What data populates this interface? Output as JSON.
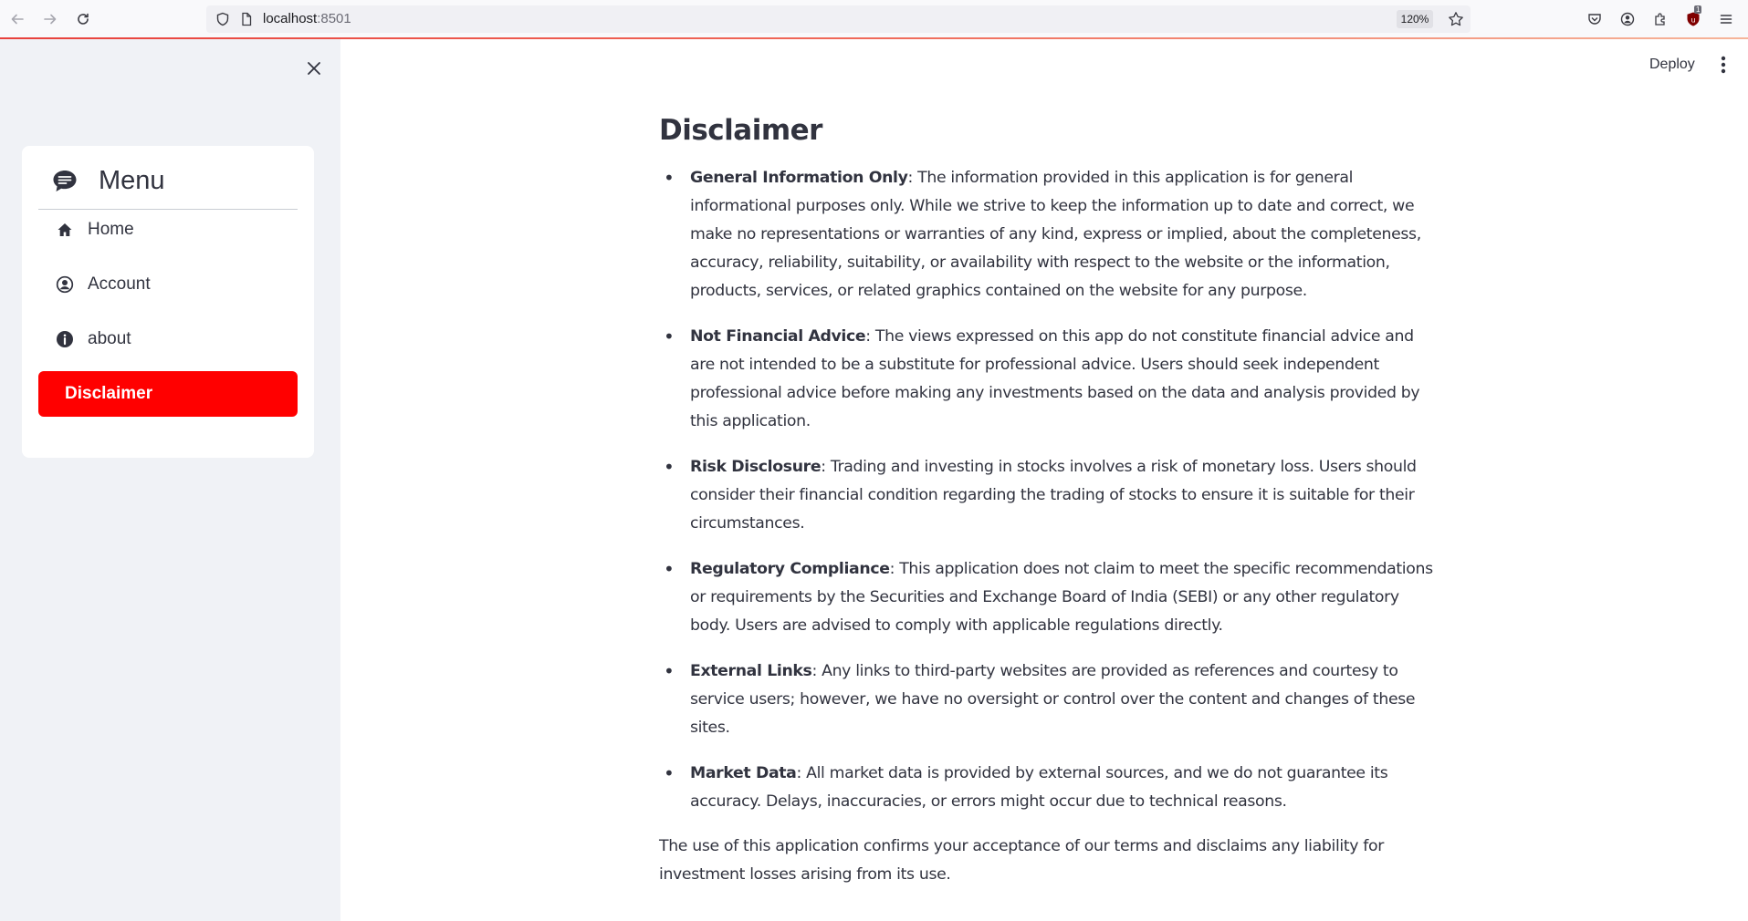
{
  "browser": {
    "url_host": "localhost",
    "url_port": ":8501",
    "zoom": "120%",
    "extension_badge": "1"
  },
  "sidebar": {
    "menu_title": "Menu",
    "items": [
      {
        "label": "Home",
        "icon": "house-icon"
      },
      {
        "label": "Account",
        "icon": "person-circle-icon"
      },
      {
        "label": "about",
        "icon": "info-circle-icon"
      },
      {
        "label": "Disclaimer",
        "icon": "",
        "active": true
      }
    ],
    "accent_color": "#ff0000"
  },
  "header": {
    "deploy_label": "Deploy"
  },
  "main": {
    "title": "Disclaimer",
    "points": [
      {
        "heading": "General Information Only",
        "text": ": The information provided in this application is for general informational purposes only. While we strive to keep the information up to date and correct, we make no representations or warranties of any kind, express or implied, about the completeness, accuracy, reliability, suitability, or availability with respect to the website or the information, products, services, or related graphics contained on the website for any purpose."
      },
      {
        "heading": "Not Financial Advice",
        "text": ": The views expressed on this app do not constitute financial advice and are not intended to be a substitute for professional advice. Users should seek independent professional advice before making any investments based on the data and analysis provided by this application."
      },
      {
        "heading": "Risk Disclosure",
        "text": ": Trading and investing in stocks involves a risk of monetary loss. Users should consider their financial condition regarding the trading of stocks to ensure it is suitable for their circumstances."
      },
      {
        "heading": "Regulatory Compliance",
        "text": ": This application does not claim to meet the specific recommendations or requirements by the Securities and Exchange Board of India (SEBI) or any other regulatory body. Users are advised to comply with applicable regulations directly."
      },
      {
        "heading": "External Links",
        "text": ": Any links to third-party websites are provided as references and courtesy to service users; however, we have no oversight or control over the content and changes of these sites."
      },
      {
        "heading": "Market Data",
        "text": ": All market data is provided by external sources, and we do not guarantee its accuracy. Delays, inaccuracies, or errors might occur due to technical reasons."
      }
    ],
    "closing": "The use of this application confirms your acceptance of our terms and disclaims any liability for investment losses arising from its use."
  }
}
